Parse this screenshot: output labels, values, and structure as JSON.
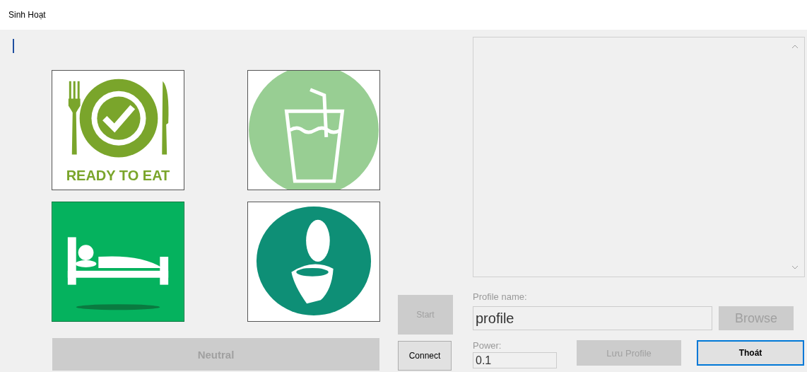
{
  "window": {
    "title": "Sinh Hoạt"
  },
  "tiles": [
    {
      "kind": "food",
      "caption": "READY TO EAT"
    },
    {
      "kind": "drink"
    },
    {
      "kind": "sleep"
    },
    {
      "kind": "toilet"
    }
  ],
  "neutral_button": {
    "label": "Neutral",
    "disabled": true
  },
  "start_button": {
    "label": "Start",
    "disabled": true
  },
  "connect_button": {
    "label": "Connect",
    "disabled": false
  },
  "profile_name": {
    "label": "Profile name:",
    "value": "profile"
  },
  "browse_button": {
    "label": "Browse",
    "disabled": true
  },
  "power": {
    "label": "Power:",
    "value": "0.1"
  },
  "save_button": {
    "label": "Lưu Profile",
    "disabled": true,
    "focused": false
  },
  "exit_button": {
    "label": "Thoát",
    "disabled": false,
    "focused": true
  }
}
